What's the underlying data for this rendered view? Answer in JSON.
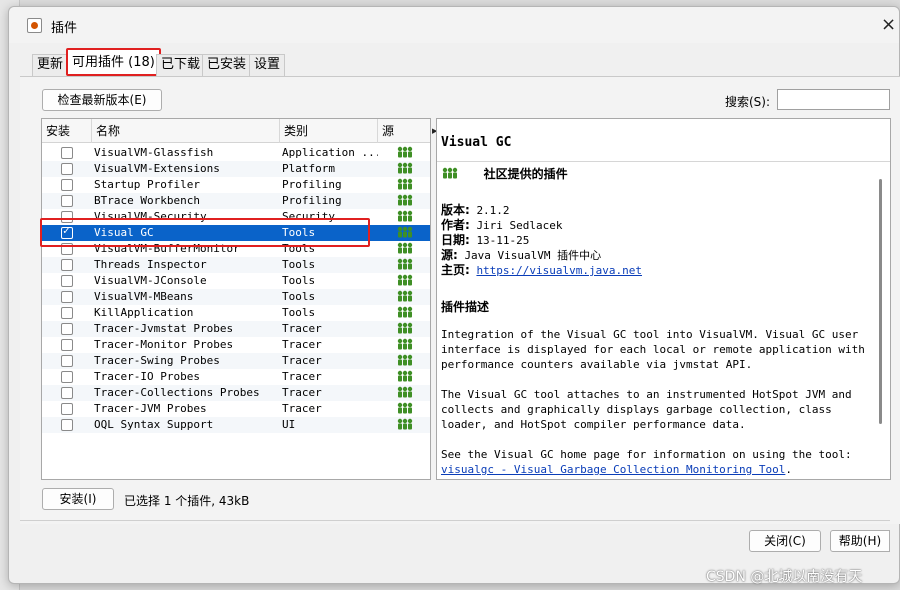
{
  "dialog": {
    "title": "插件",
    "close_glyph": "×"
  },
  "background_glyphs": [
    "文",
    "▸",
    "▸"
  ],
  "tabs": [
    {
      "label": "更新",
      "active": false
    },
    {
      "label": "可用插件 (18)",
      "active": true
    },
    {
      "label": "已下载",
      "active": false
    },
    {
      "label": "已安装",
      "active": false
    },
    {
      "label": "设置",
      "active": false
    }
  ],
  "toolbar": {
    "check_latest_label": "检查最新版本(E)",
    "search_label": "搜索(S):",
    "search_value": ""
  },
  "table": {
    "headers": {
      "install": "安装",
      "name": "名称",
      "category": "类别",
      "source": "源"
    },
    "source_icon": "community-people-icon",
    "rows": [
      {
        "checked": false,
        "name": "VisualVM-Glassfish",
        "category": "Application ..."
      },
      {
        "checked": false,
        "name": "VisualVM-Extensions",
        "category": "Platform"
      },
      {
        "checked": false,
        "name": "Startup Profiler",
        "category": "Profiling"
      },
      {
        "checked": false,
        "name": "BTrace Workbench",
        "category": "Profiling"
      },
      {
        "checked": false,
        "name": "VisualVM-Security",
        "category": "Security"
      },
      {
        "checked": true,
        "name": "Visual GC",
        "category": "Tools",
        "selected": true
      },
      {
        "checked": false,
        "name": "VisualVM-BufferMonitor",
        "category": "Tools"
      },
      {
        "checked": false,
        "name": "Threads Inspector",
        "category": "Tools"
      },
      {
        "checked": false,
        "name": "VisualVM-JConsole",
        "category": "Tools"
      },
      {
        "checked": false,
        "name": "VisualVM-MBeans",
        "category": "Tools"
      },
      {
        "checked": false,
        "name": "KillApplication",
        "category": "Tools"
      },
      {
        "checked": false,
        "name": "Tracer-Jvmstat Probes",
        "category": "Tracer"
      },
      {
        "checked": false,
        "name": "Tracer-Monitor Probes",
        "category": "Tracer"
      },
      {
        "checked": false,
        "name": "Tracer-Swing Probes",
        "category": "Tracer"
      },
      {
        "checked": false,
        "name": "Tracer-IO Probes",
        "category": "Tracer"
      },
      {
        "checked": false,
        "name": "Tracer-Collections Probes",
        "category": "Tracer"
      },
      {
        "checked": false,
        "name": "Tracer-JVM Probes",
        "category": "Tracer"
      },
      {
        "checked": false,
        "name": "OQL Syntax Support",
        "category": "UI"
      }
    ]
  },
  "details": {
    "title": "Visual GC",
    "provider_text": "社区提供的插件",
    "version_label": "版本:",
    "version": "2.1.2",
    "author_label": "作者:",
    "author": "Jiri Sedlacek",
    "date_label": "日期:",
    "date": "13-11-25",
    "source_label": "源:",
    "source": "Java VisualVM 插件中心",
    "homepage_label": "主页:",
    "homepage": "https://visualvm.java.net",
    "description_heading": "插件描述",
    "desc_p1": "Integration of the Visual GC tool into VisualVM. Visual GC user interface is displayed for each local or remote application with performance counters available via jvmstat API.",
    "desc_p2": "The Visual GC tool attaches to an instrumented HotSpot JVM and collects and graphically displays garbage collection, class loader, and HotSpot compiler performance data.",
    "desc_p3_prefix": "See the Visual GC home page for information on using the tool:",
    "desc_p3_link": "visualgc - Visual Garbage Collection Monitoring Tool",
    "desc_p3_suffix": "."
  },
  "footer": {
    "install_label": "安装(I)",
    "status": "已选择 1 个插件, 43kB",
    "close_label": "关闭(C)",
    "help_label": "帮助(H)"
  },
  "watermark": "CSDN @北城以南没有天"
}
